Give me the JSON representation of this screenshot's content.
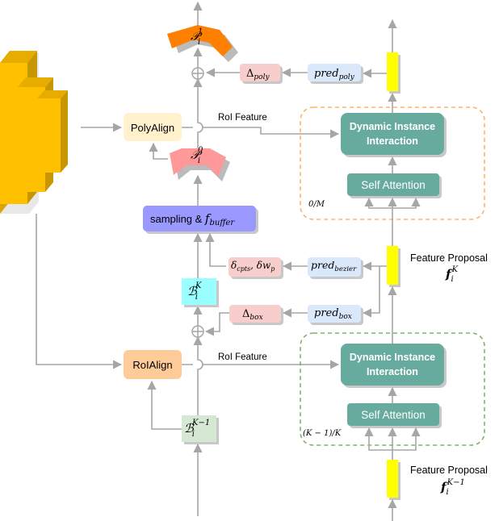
{
  "colors": {
    "feature_map": "#FFC000",
    "poly_align": "#FFF2CC",
    "roi_align": "#FFCC99",
    "delta": "#F8CECC",
    "pred": "#DAE8FC",
    "dynamic_interaction": "#67AB9F",
    "sampling": "#9999FF",
    "box_k": "#99FFFF",
    "box_k_minus_1": "#D5E8D4",
    "polygon_0": "#FF9999",
    "polygon_1": "#FF8000",
    "feature_proposal": "#FFFF00",
    "stage_top_border": "#FFB366",
    "stage_bottom_border": "#82B366",
    "arrows": "#A6A6A6"
  },
  "top_stage": {
    "polygon_out": {
      "base": "𝒫",
      "sub": "i",
      "sup": "1"
    },
    "polygon_in": {
      "base": "𝒫",
      "sub": "i",
      "sup": "0"
    },
    "delta_poly": {
      "base": "Δ",
      "sub": "poly"
    },
    "pred_poly": {
      "base": "pred",
      "sub": "poly"
    },
    "poly_align": "PolyAlign",
    "roi_feature": "RoI Feature",
    "dynamic_interaction": [
      "Dynamic Instance",
      "Interaction"
    ],
    "self_attention": "Self Attention",
    "stage_label": "0/M"
  },
  "middle": {
    "sampling": {
      "text": "sampling & ",
      "base": "f",
      "sub": "buffer"
    },
    "delta_bezier": {
      "a": "δ",
      "a_sub": "cpts",
      "sep": ", ",
      "b": "δw",
      "b_sub": "p"
    },
    "pred_bezier": {
      "base": "pred",
      "sub": "bezier"
    },
    "box_k": {
      "base": "ℬ",
      "sub": "i",
      "sup": "K"
    },
    "delta_box": {
      "base": "Δ",
      "sub": "box"
    },
    "pred_box": {
      "base": "pred",
      "sub": "box"
    },
    "feature_proposal_label": "Feature Proposal",
    "feature_proposal_math": {
      "base": "f",
      "sub": "i",
      "sup": "K"
    }
  },
  "bottom_stage": {
    "roi_align": "RoIAlign",
    "roi_feature": "RoI Feature",
    "dynamic_interaction": [
      "Dynamic Instance",
      "Interaction"
    ],
    "self_attention": "Self Attention",
    "stage_label": "(K − 1)/K",
    "box_k_minus_1": {
      "base": "ℬ",
      "sub": "i",
      "sup": "K−1"
    },
    "feature_proposal_label": "Feature Proposal",
    "feature_proposal_math": {
      "base": "f",
      "sub": "i",
      "sup": "K−1"
    }
  }
}
